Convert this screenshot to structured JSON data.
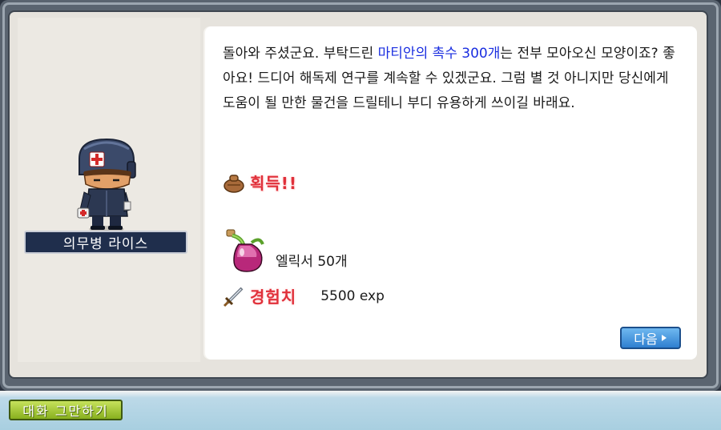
{
  "npc": {
    "name": "의무병 라이스"
  },
  "message": {
    "part1": "돌아와 주셨군요. 부탁드린 ",
    "highlight": "마티안의 촉수 300개",
    "part2": "는 전부 모아오신 모양이죠? 좋아요! 드디어 해독제 연구를 계속할 수 있겠군요. 그럼 별 것 아니지만 당신에게 도움이 될 만한 물건을 드릴테니 부디 유용하게 쓰이길 바래요."
  },
  "reward": {
    "obtain_label": "획득!!",
    "item_name": "엘릭서 50개",
    "exp_label": "경험치",
    "exp_value": "5500 exp"
  },
  "buttons": {
    "next": "다음",
    "quit": "대화 그만하기"
  },
  "colors": {
    "highlight": "#1a2ee0",
    "reward_label": "#e0303a",
    "next_button": "#2f7fd0",
    "quit_button": "#88b01e",
    "name_plate": "#1f2e4c"
  },
  "icons": {
    "obtain": "bag-icon",
    "item": "potion-flask-icon",
    "exp": "sword-icon",
    "next": "arrow-right-icon"
  }
}
